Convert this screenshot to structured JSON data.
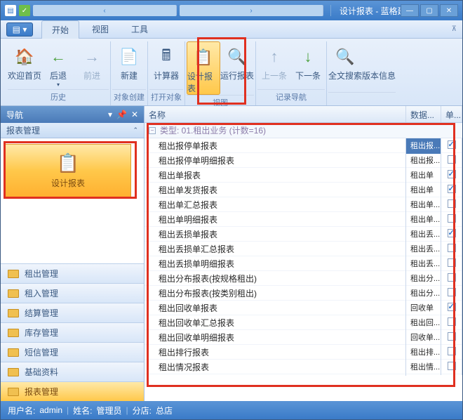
{
  "title": "设计报表 - 蓝格建材租赁管理软件[试用版本] 免费解答任何疑问 Email: zulin@l...",
  "tabs": {
    "start": "开始",
    "view": "视图",
    "tool": "工具"
  },
  "ribbon": {
    "home": {
      "label": "欢迎首页"
    },
    "back": {
      "label": "后退"
    },
    "fwd": {
      "label": "前进"
    },
    "new": {
      "label": "新建"
    },
    "calc": {
      "label": "计算器"
    },
    "design": {
      "label": "设计报表"
    },
    "run": {
      "label": "运行报表"
    },
    "prev": {
      "label": "上一条"
    },
    "next": {
      "label": "下一条"
    },
    "search": {
      "label": "全文搜索"
    },
    "ver": {
      "label": "版本信息"
    },
    "g_history": "历史",
    "g_create": "对象创建",
    "g_open": "打开对象",
    "g_view": "视图",
    "g_nav": "记录导航"
  },
  "nav": {
    "title": "导航",
    "section": "报表管理",
    "design": "设计报表",
    "cats": [
      "租出管理",
      "租入管理",
      "结算管理",
      "库存管理",
      "短信管理",
      "基础资料",
      "报表管理"
    ]
  },
  "grid": {
    "col_name": "名称",
    "col_db": "数据...",
    "col_chk": "单...",
    "group": "类型: 01.租出业务  (计数=16)",
    "rows": [
      {
        "name": "租出报停单报表",
        "db": "租出报...",
        "chk": true,
        "sel": true
      },
      {
        "name": "租出报停单明细报表",
        "db": "租出报...",
        "chk": false
      },
      {
        "name": "租出单报表",
        "db": "租出单",
        "chk": true
      },
      {
        "name": "租出单发货报表",
        "db": "租出单",
        "chk": true
      },
      {
        "name": "租出单汇总报表",
        "db": "租出单...",
        "chk": false
      },
      {
        "name": "租出单明细报表",
        "db": "租出单...",
        "chk": false
      },
      {
        "name": "租出丢损单报表",
        "db": "租出丢...",
        "chk": true
      },
      {
        "name": "租出丢损单汇总报表",
        "db": "租出丢...",
        "chk": false
      },
      {
        "name": "租出丢损单明细报表",
        "db": "租出丢...",
        "chk": false
      },
      {
        "name": "租出分布报表(按规格租出)",
        "db": "租出分...",
        "chk": false
      },
      {
        "name": "租出分布报表(按类别租出)",
        "db": "租出分...",
        "chk": false
      },
      {
        "name": "租出回收单报表",
        "db": "回收单",
        "chk": true
      },
      {
        "name": "租出回收单汇总报表",
        "db": "租出回...",
        "chk": false
      },
      {
        "name": "租出回收单明细报表",
        "db": "回收单...",
        "chk": false
      },
      {
        "name": "租出排行报表",
        "db": "租出排...",
        "chk": false
      },
      {
        "name": "租出情况报表",
        "db": "租出情...",
        "chk": false
      }
    ]
  },
  "status": {
    "user_l": "用户名:",
    "user_v": "admin",
    "name_l": "姓名:",
    "name_v": "管理员",
    "branch_l": "分店:",
    "branch_v": "总店"
  }
}
